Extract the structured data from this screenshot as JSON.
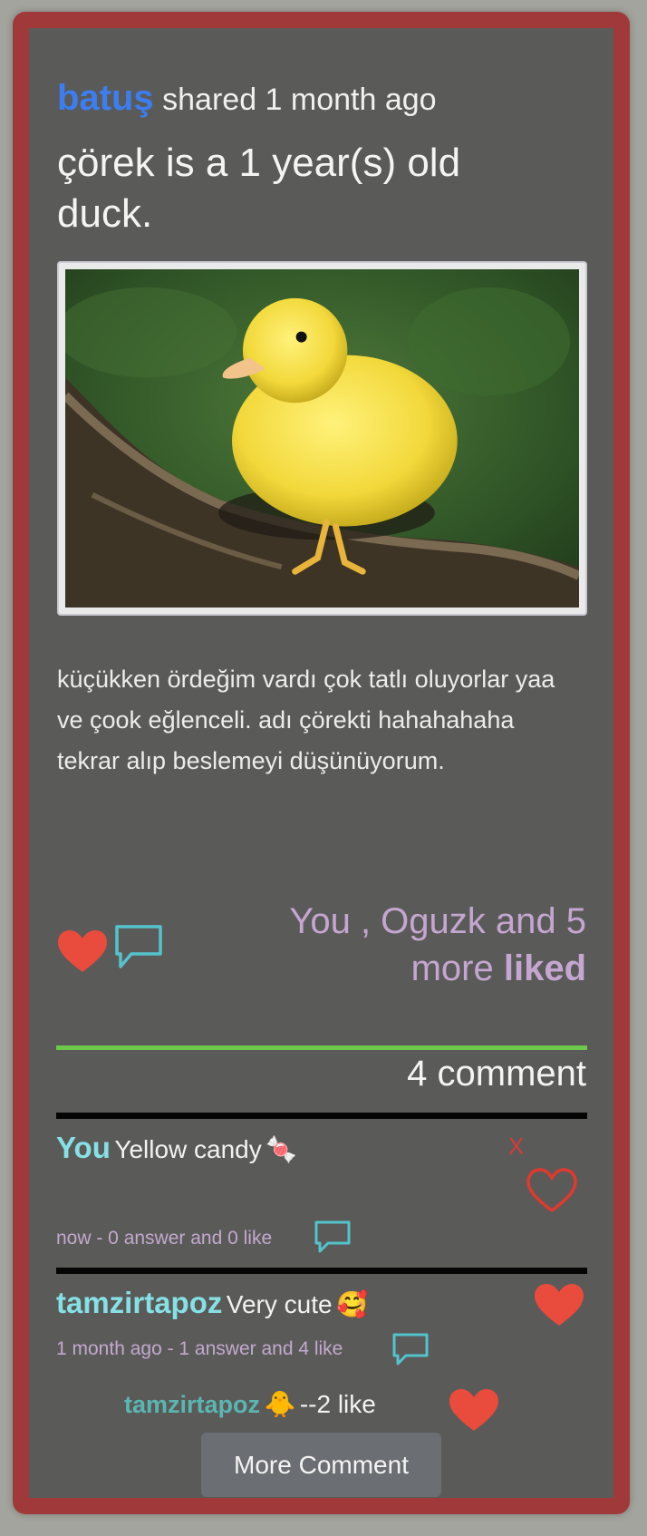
{
  "post": {
    "username": "batuş",
    "shared_text": "shared 1 month ago",
    "title": "çörek is a 1 year(s) old duck.",
    "description": "küçükken ördeğim vardı çok tatlı oluyorlar yaa ve çook eğlenceli. adı çörekti hahahahaha tekrar alıp beslemeyi düşünüyorum."
  },
  "likes": {
    "text": "You , Oguzk and 5 more",
    "strong": "liked"
  },
  "comments": {
    "count_label": "4 comment",
    "items": [
      {
        "user": "You",
        "text": "Yellow candy",
        "emoji": "🍬",
        "meta": "now - 0 answer and 0 like",
        "delete_label": "X"
      },
      {
        "user": "tamzirtapoz",
        "text": "Very cute",
        "emoji": "🥰",
        "meta": "1 month ago - 1 answer and 4 like"
      }
    ],
    "reply": {
      "user": "tamzirtapoz",
      "emoji": "🐥",
      "likes": "--2 like"
    },
    "more_label": "More Comment"
  },
  "colors": {
    "border": "#a03a3a",
    "card": "#5a5a59",
    "username": "#3c7ef0",
    "likes_text": "#c4a6d0",
    "comment_user": "#86e0e4",
    "heart": "#e94b3c",
    "chat_icon": "#54c3cc",
    "divider": "#6cc94c"
  },
  "icons": {
    "like": "heart-icon",
    "comment": "speech-bubble-icon",
    "unliked": "heart-outline-icon"
  }
}
